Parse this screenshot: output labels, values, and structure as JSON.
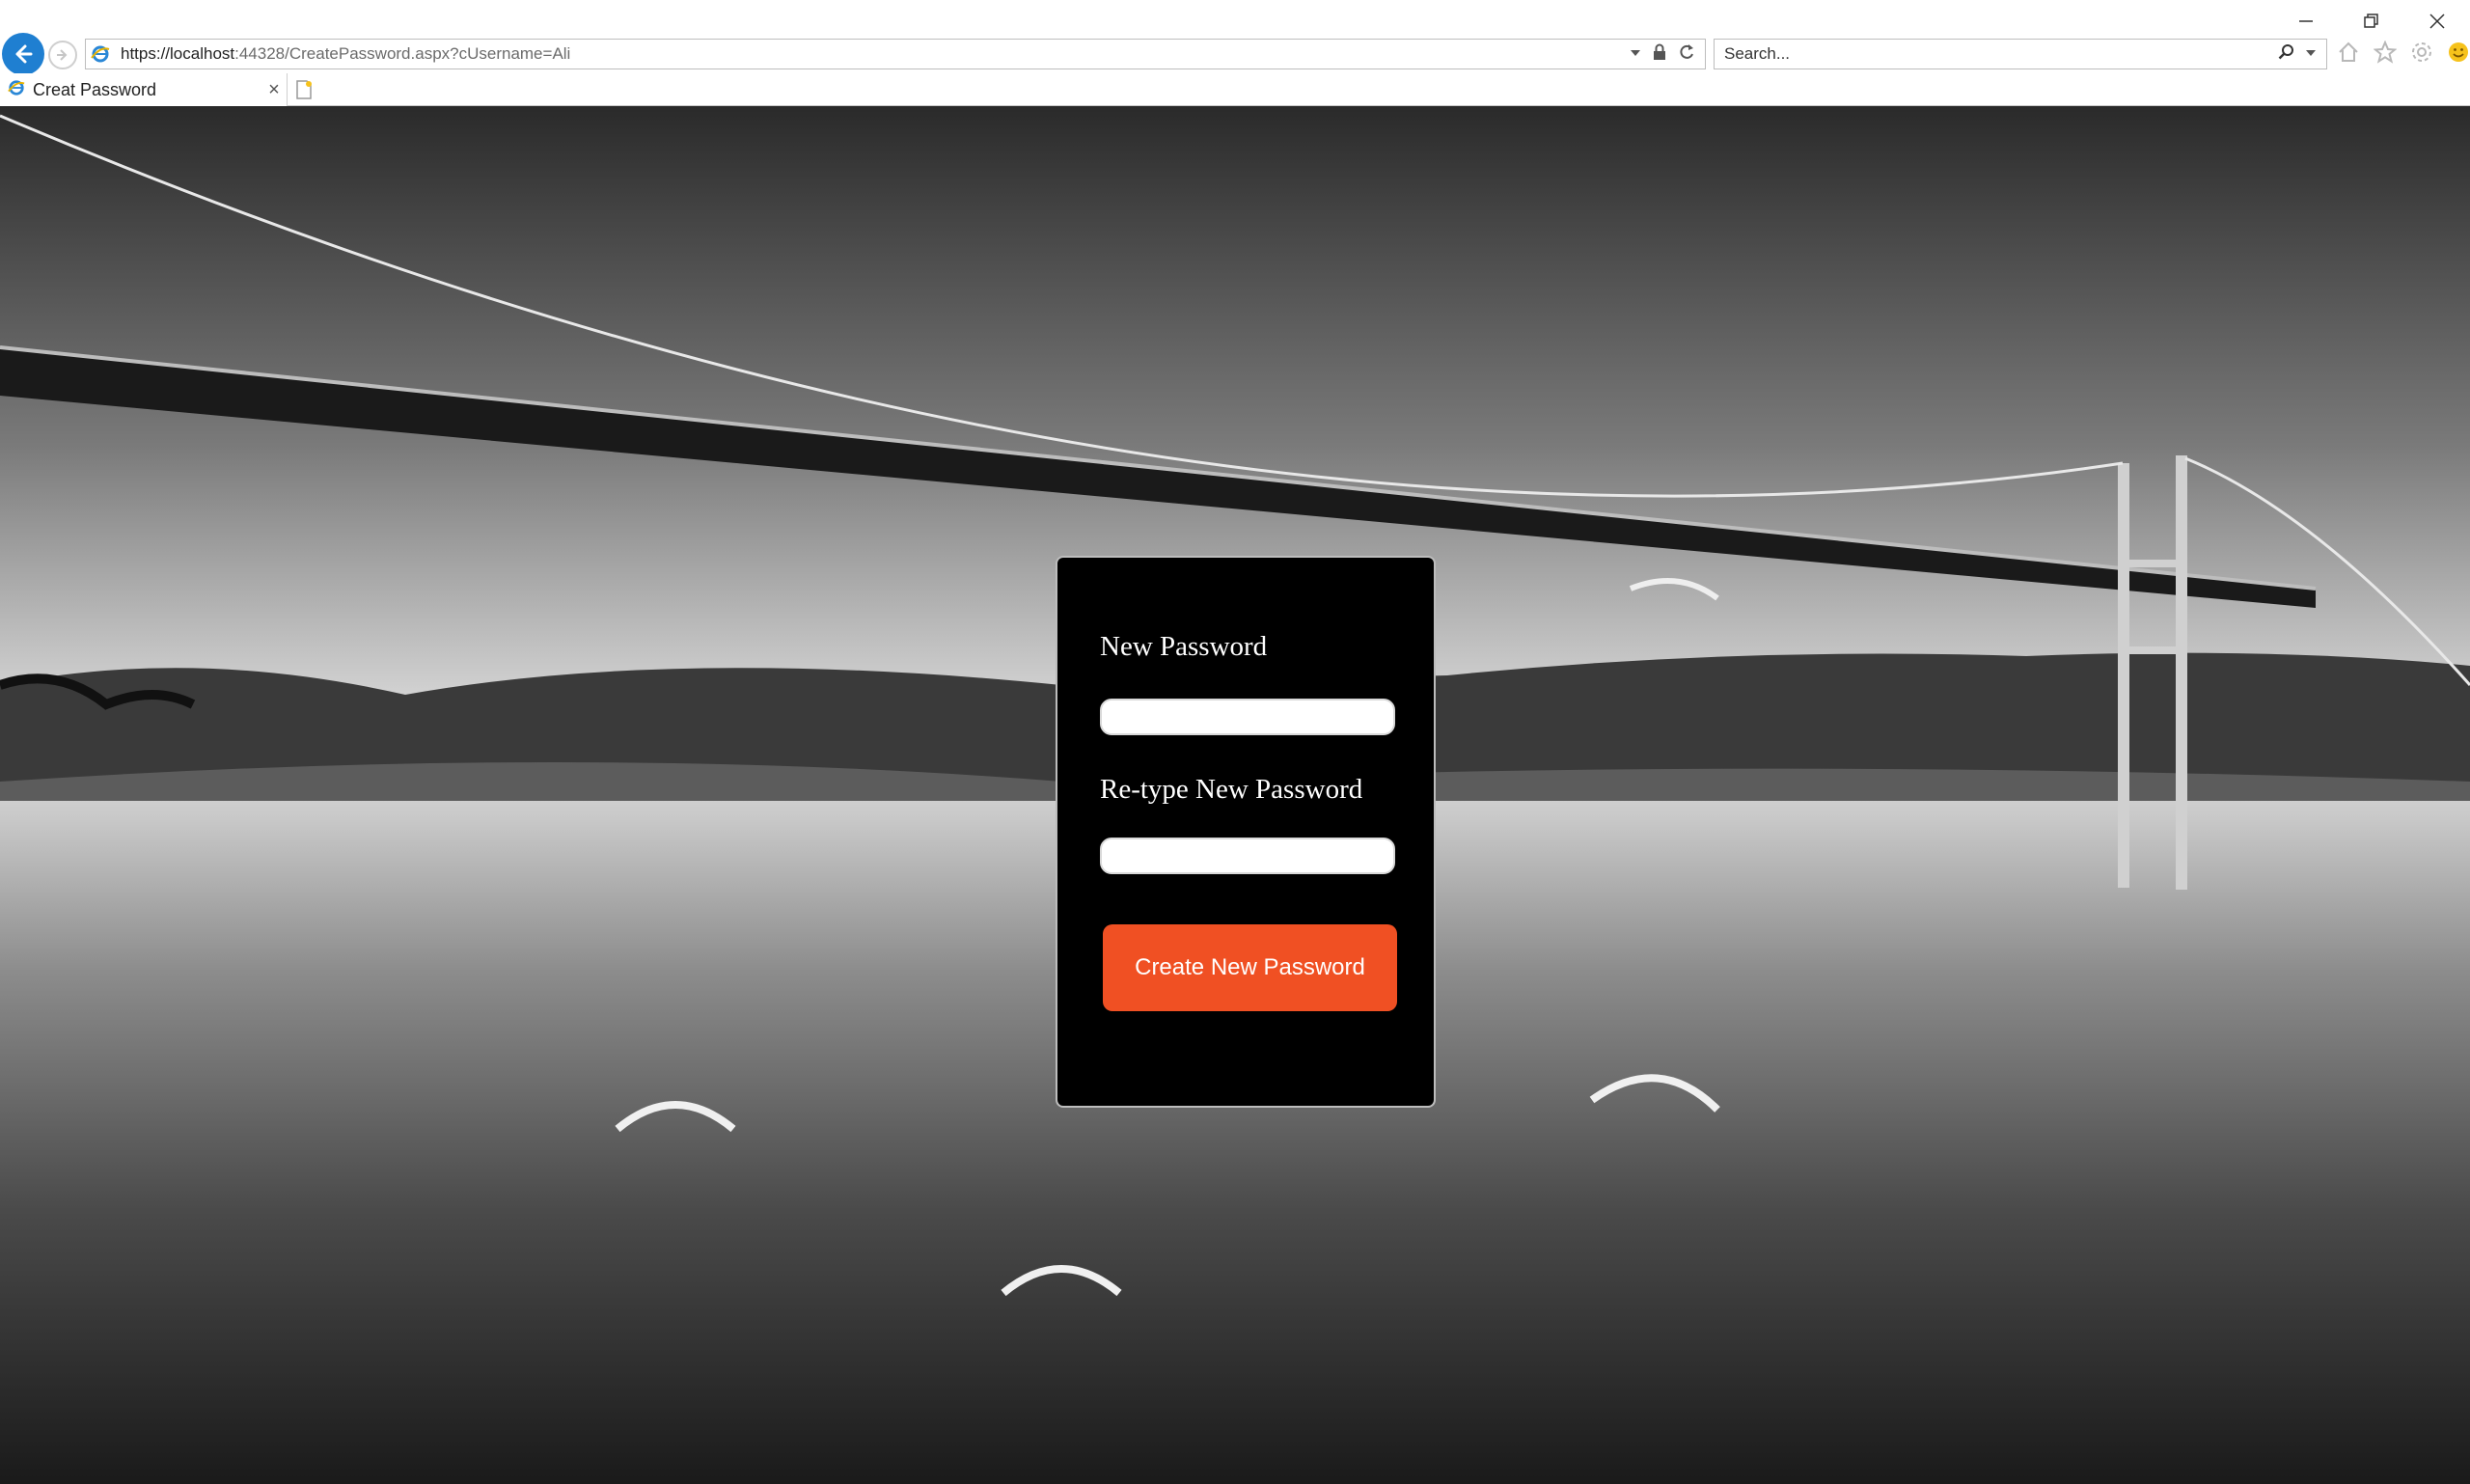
{
  "browser": {
    "url_host": "https://localhost",
    "url_rest": ":44328/CreatePassword.aspx?cUsername=Ali",
    "search_placeholder": "Search...",
    "tab_title": "Creat Password",
    "icons": [
      "back-arrow-icon",
      "forward-arrow-icon",
      "ie-favicon-icon",
      "dropdown-icon",
      "lock-icon",
      "refresh-icon",
      "search-icon",
      "home-icon",
      "favorites-star-icon",
      "settings-gear-icon",
      "smiley-feedback-icon",
      "minimize-icon",
      "restore-icon",
      "close-icon",
      "tab-close-icon",
      "new-tab-icon"
    ]
  },
  "form": {
    "new_password_label": "New Password",
    "new_password_value": "",
    "retype_password_label": "Re-type New Password",
    "retype_password_value": "",
    "submit_label": "Create New Password",
    "accent_color": "#f05023"
  }
}
